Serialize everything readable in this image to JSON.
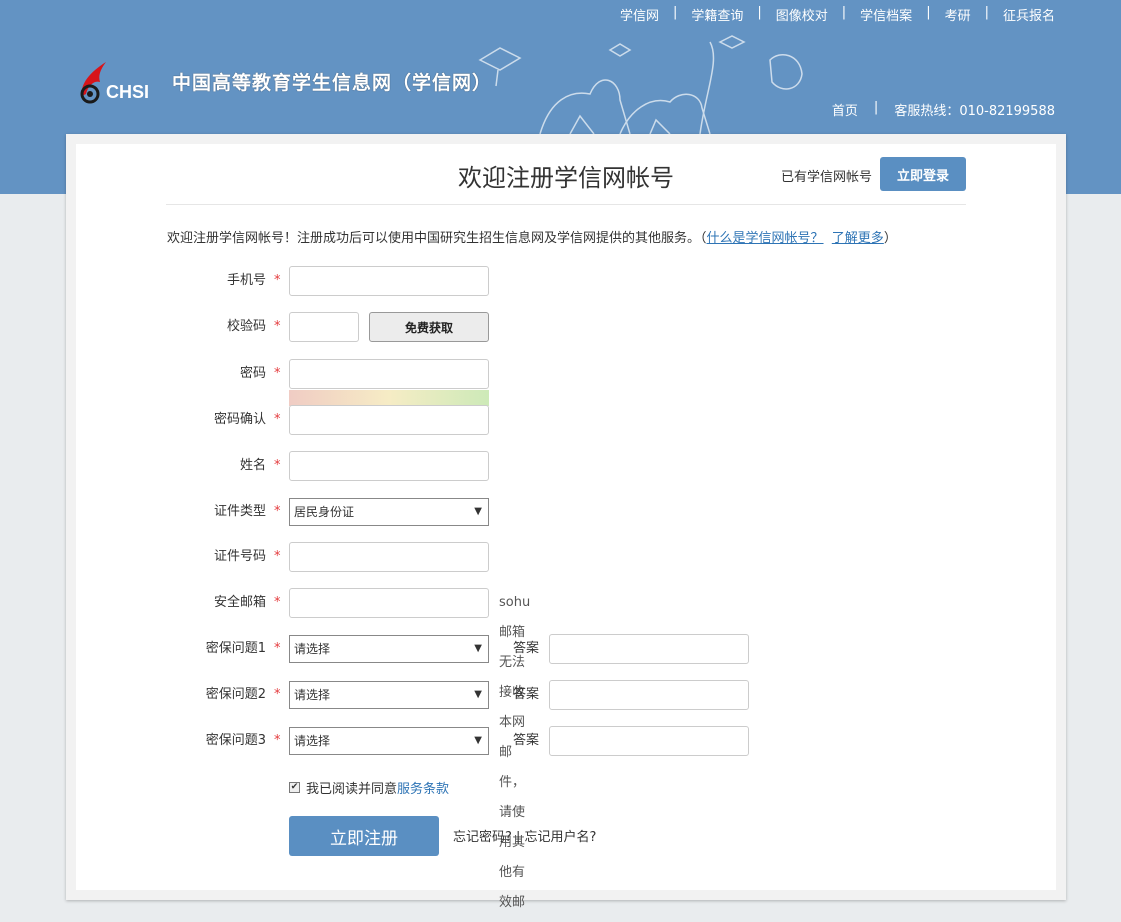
{
  "topnav": [
    "学信网",
    "学籍查询",
    "图像校对",
    "学信档案",
    "考研",
    "征兵报名"
  ],
  "brand": {
    "logo_text": "CHSI",
    "site_name": "中国高等教育学生信息网（学信网）"
  },
  "subnav": {
    "home": "首页",
    "hotline": "客服热线：010-82199588"
  },
  "page": {
    "title": "欢迎注册学信网帐号",
    "has_account": "已有学信网帐号",
    "login_button": "立即登录",
    "intro_prefix": "欢迎注册学信网帐号！注册成功后可以使用中国研究生招生信息网及学信网提供的其他服务。（",
    "intro_link1": "什么是学信网帐号？",
    "intro_link2": "了解更多",
    "intro_suffix": "）"
  },
  "form": {
    "required_mark": "*",
    "phone_label": "手机号",
    "captcha_label": "校验码",
    "captcha_button": "免费获取",
    "password_label": "密码",
    "password_confirm_label": "密码确认",
    "name_label": "姓名",
    "id_type_label": "证件类型",
    "id_type_value": "居民身份证",
    "id_number_label": "证件号码",
    "email_label": "安全邮箱",
    "email_hint": "sohu邮箱无法接收本网邮件，请使用其他有效邮箱",
    "security_questions": [
      {
        "label": "密保问题1",
        "value": "请选择",
        "answer_label": "答案"
      },
      {
        "label": "密保问题2",
        "value": "请选择",
        "answer_label": "答案"
      },
      {
        "label": "密保问题3",
        "value": "请选择",
        "answer_label": "答案"
      }
    ],
    "agree_text": "我已阅读并同意",
    "terms_link": "服务条款",
    "agree_checked": true,
    "submit_button": "立即注册",
    "forgot_text": "忘记密码? | 忘记用户名?"
  },
  "colors": {
    "banner": "#6393c3",
    "button": "#5a8fc2",
    "link": "#2e74b5",
    "required": "#e4393c"
  }
}
